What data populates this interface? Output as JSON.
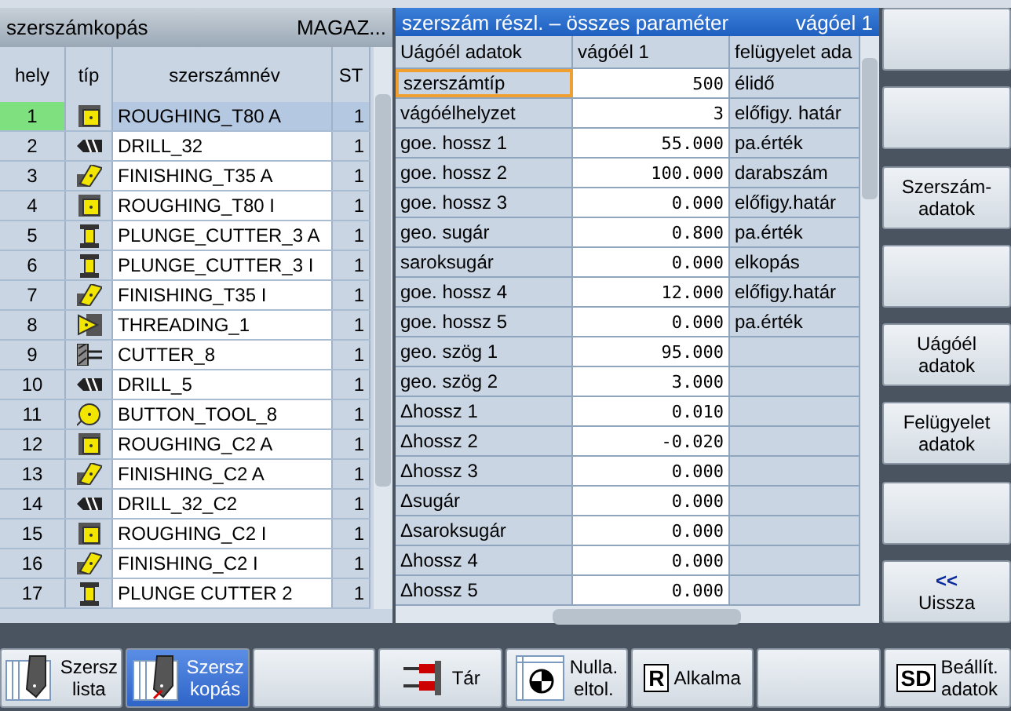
{
  "tool_list": {
    "title": "szerszámkopás",
    "magazine": "MAGAZ...",
    "columns": [
      "hely",
      "típ",
      "szerszámnév",
      "ST"
    ],
    "rows": [
      {
        "place": "1",
        "kind": "roughing",
        "name": "ROUGHING_T80 A",
        "st": "1",
        "selected": true
      },
      {
        "place": "2",
        "kind": "drill",
        "name": "DRILL_32",
        "st": "1",
        "selected": false
      },
      {
        "place": "3",
        "kind": "finishing",
        "name": "FINISHING_T35 A",
        "st": "1",
        "selected": false
      },
      {
        "place": "4",
        "kind": "roughing",
        "name": "ROUGHING_T80 I",
        "st": "1",
        "selected": false
      },
      {
        "place": "5",
        "kind": "plunge",
        "name": "PLUNGE_CUTTER_3 A",
        "st": "1",
        "selected": false
      },
      {
        "place": "6",
        "kind": "plunge",
        "name": "PLUNGE_CUTTER_3 I",
        "st": "1",
        "selected": false
      },
      {
        "place": "7",
        "kind": "finishing",
        "name": "FINISHING_T35 I",
        "st": "1",
        "selected": false
      },
      {
        "place": "8",
        "kind": "threading",
        "name": "THREADING_1",
        "st": "1",
        "selected": false
      },
      {
        "place": "9",
        "kind": "cutter",
        "name": "CUTTER_8",
        "st": "1",
        "selected": false
      },
      {
        "place": "10",
        "kind": "drill",
        "name": "DRILL_5",
        "st": "1",
        "selected": false
      },
      {
        "place": "11",
        "kind": "button",
        "name": "BUTTON_TOOL_8",
        "st": "1",
        "selected": false
      },
      {
        "place": "12",
        "kind": "roughing",
        "name": "ROUGHING_C2 A",
        "st": "1",
        "selected": false
      },
      {
        "place": "13",
        "kind": "finishing",
        "name": "FINISHING_C2 A",
        "st": "1",
        "selected": false
      },
      {
        "place": "14",
        "kind": "drill",
        "name": "DRILL_32_C2",
        "st": "1",
        "selected": false
      },
      {
        "place": "15",
        "kind": "roughing",
        "name": "ROUGHING_C2 I",
        "st": "1",
        "selected": false
      },
      {
        "place": "16",
        "kind": "finishing",
        "name": "FINISHING_C2 I",
        "st": "1",
        "selected": false
      },
      {
        "place": "17",
        "kind": "plunge",
        "name": "PLUNGE CUTTER 2",
        "st": "1",
        "selected": false
      }
    ]
  },
  "details": {
    "title": "szerszám részl. – összes paraméter",
    "edge": "vágóel 1",
    "columns": [
      "Uágóél adatok",
      "vágóél 1",
      "felügyelet ada"
    ],
    "rows": [
      {
        "param": "szerszámtíp",
        "value": "500",
        "monitor": "élidő",
        "selected": true
      },
      {
        "param": "vágóélhelyzet",
        "value": "3",
        "monitor": "előfigy. határ",
        "selected": false
      },
      {
        "param": "goe. hossz 1",
        "value": "55.000",
        "monitor": "pa.érték",
        "selected": false
      },
      {
        "param": "goe. hossz 2",
        "value": "100.000",
        "monitor": "darabszám",
        "selected": false
      },
      {
        "param": "goe. hossz 3",
        "value": "0.000",
        "monitor": "előfigy.határ",
        "selected": false
      },
      {
        "param": "geo. sugár",
        "value": "0.800",
        "monitor": "pa.érték",
        "selected": false
      },
      {
        "param": "saroksugár",
        "value": "0.000",
        "monitor": "elkopás",
        "selected": false
      },
      {
        "param": "goe. hossz 4",
        "value": "12.000",
        "monitor": "előfigy.határ",
        "selected": false
      },
      {
        "param": "goe. hossz 5",
        "value": "0.000",
        "monitor": "pa.érték",
        "selected": false
      },
      {
        "param": "geo. szög 1",
        "value": "95.000",
        "selected": false
      },
      {
        "param": "geo. szög 2",
        "value": "3.000",
        "selected": false
      },
      {
        "param": "Δhossz 1",
        "value": "0.010",
        "selected": false
      },
      {
        "param": "Δhossz 2",
        "value": "-0.020",
        "selected": false
      },
      {
        "param": "Δhossz 3",
        "value": "0.000",
        "selected": false
      },
      {
        "param": "Δsugár",
        "value": "0.000",
        "selected": false
      },
      {
        "param": "Δsaroksugár",
        "value": "0.000",
        "selected": false
      },
      {
        "param": "Δhossz 4",
        "value": "0.000",
        "selected": false
      },
      {
        "param": "Δhossz 5",
        "value": "0.000",
        "selected": false
      }
    ]
  },
  "vertical_softkeys": [
    {
      "kind": "blank"
    },
    {
      "kind": "blank"
    },
    {
      "kind": "text",
      "label": "Szerszám-\nadatok"
    },
    {
      "kind": "blank"
    },
    {
      "kind": "text",
      "label": "Uágóél\nadatok"
    },
    {
      "kind": "text",
      "label": "Felügyelet\nadatok"
    },
    {
      "kind": "blank"
    },
    {
      "label": "Uissza",
      "kind": "back",
      "arrow": "<<"
    }
  ],
  "horizontal_softkeys": [
    {
      "label": "Szersz\nlista",
      "kind": "tool",
      "selected": false
    },
    {
      "label": "Szersz\nkopás",
      "kind": "tool",
      "selected": true
    },
    {
      "selected": false
    },
    {
      "label": "Tár",
      "kind": "magazine",
      "selected": false
    },
    {
      "label": "Nulla.\neltol.",
      "kind": "crosshair",
      "selected": false
    },
    {
      "label": "Alkalma",
      "kind": "letter",
      "icon_text": "R",
      "selected": false
    },
    {
      "selected": false
    },
    {
      "label": "Beállít.\nadatok",
      "kind": "letter",
      "icon_text": "SD",
      "selected": false
    }
  ]
}
